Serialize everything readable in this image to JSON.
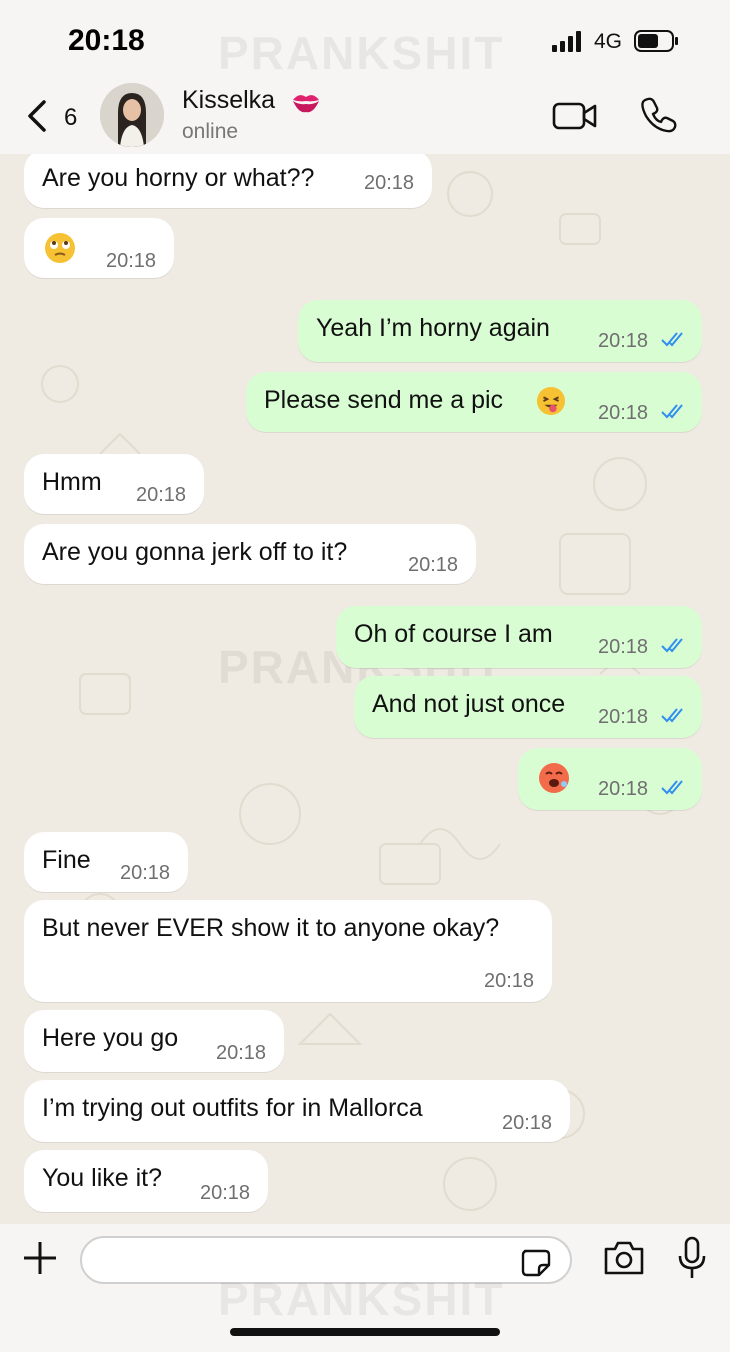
{
  "status_bar": {
    "time": "20:18",
    "network": "4G"
  },
  "watermark": "PRANKSHIT",
  "header": {
    "back_count": "6",
    "contact_name": "Kisselka",
    "contact_status": "online"
  },
  "messages": [
    {
      "dir": "in",
      "text": "Are you horny or what??",
      "time": "20:18"
    },
    {
      "dir": "in",
      "text": "",
      "emoji": "rolling-eyes-emoji",
      "time": "20:18"
    },
    {
      "dir": "out",
      "text": "Yeah I’m horny again",
      "time": "20:18",
      "read": true
    },
    {
      "dir": "out",
      "text": "Please send me a pic",
      "emoji": "tongue-out-emoji",
      "time": "20:18",
      "read": true
    },
    {
      "dir": "in",
      "text": "Hmm",
      "time": "20:18"
    },
    {
      "dir": "in",
      "text": "Are you gonna jerk off to it?",
      "time": "20:18"
    },
    {
      "dir": "out",
      "text": "Oh of course I am",
      "time": "20:18",
      "read": true
    },
    {
      "dir": "out",
      "text": "And not just once",
      "time": "20:18",
      "read": true
    },
    {
      "dir": "out",
      "text": "",
      "emoji": "hot-face-emoji",
      "time": "20:18",
      "read": true
    },
    {
      "dir": "in",
      "text": "Fine",
      "time": "20:18"
    },
    {
      "dir": "in",
      "text": "But never EVER show it to anyone okay?",
      "time": "20:18"
    },
    {
      "dir": "in",
      "text": "Here you go",
      "time": "20:18"
    },
    {
      "dir": "in",
      "text": "I’m trying out outfits for in Mallorca",
      "time": "20:18"
    },
    {
      "dir": "in",
      "text": "You like it?",
      "time": "20:18"
    }
  ],
  "colors": {
    "incoming_bubble": "#ffffff",
    "outgoing_bubble": "#d9fdd3",
    "read_ticks": "#2f8ff0",
    "chat_background": "#efeae2"
  },
  "input": {
    "placeholder": ""
  }
}
